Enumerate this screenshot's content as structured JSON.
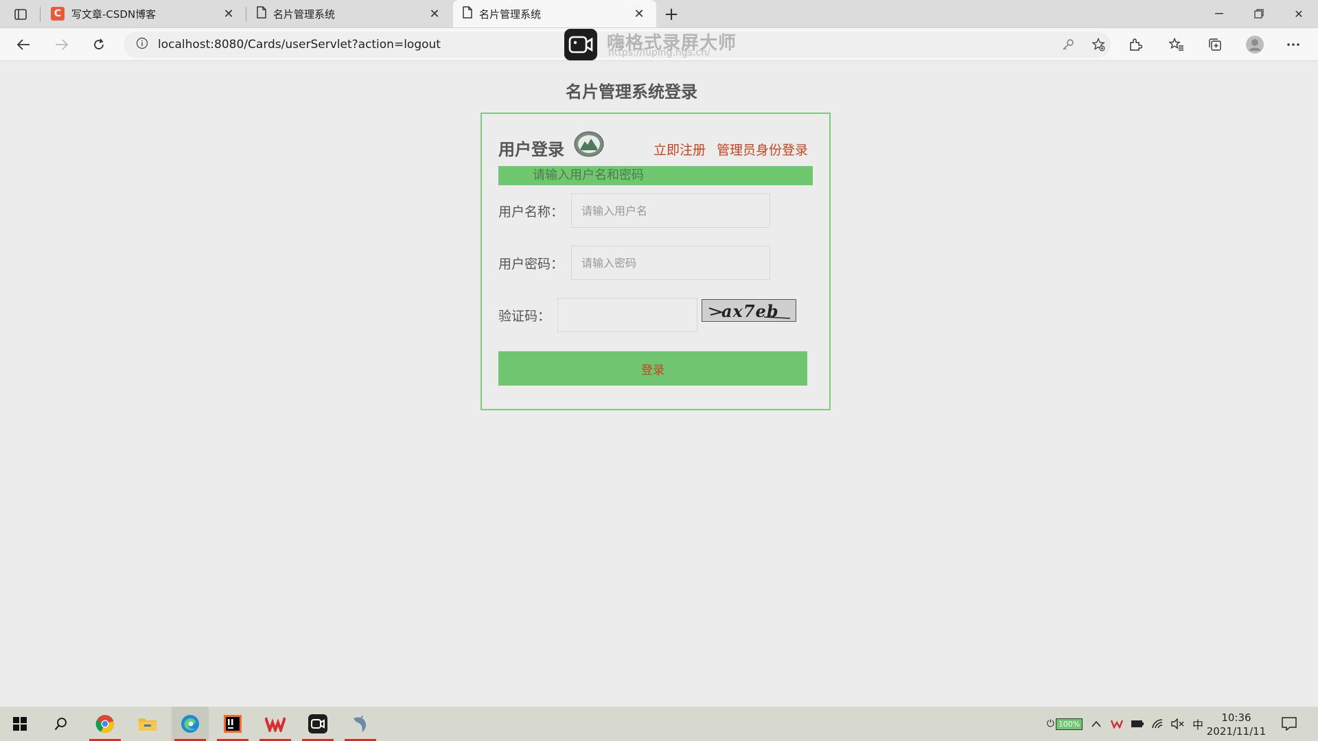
{
  "browser": {
    "tabs": [
      {
        "title": "写文章-CSDN博客",
        "icon": "csdn-icon",
        "active": false
      },
      {
        "title": "名片管理系统",
        "icon": "page-icon",
        "active": false
      },
      {
        "title": "名片管理系统",
        "icon": "page-icon",
        "active": true
      }
    ],
    "url": "localhost:8080/Cards/userServlet?action=logout"
  },
  "watermark": {
    "title": "嗨格式录屏大师",
    "url": "https://luping.hgs.cn/"
  },
  "page": {
    "title": "名片管理系统登录",
    "login": {
      "heading": "用户登录",
      "register_link": "立即注册",
      "admin_link": "管理员身份登录",
      "hint": "请输入用户名和密码",
      "username_label": "用户名称：",
      "username_placeholder": "请输入用户名",
      "password_label": "用户密码：",
      "password_placeholder": "请输入密码",
      "captcha_label": "验证码：",
      "captcha_value": "",
      "captcha_image_text": "ax7eb",
      "submit_label": "登录"
    }
  },
  "taskbar": {
    "battery": "100%",
    "ime": "中",
    "time": "10:36",
    "date": "2021/11/11"
  },
  "colors": {
    "accent_green": "#70c670",
    "link_red": "#c8431e",
    "box_border": "#7ecb7e"
  }
}
